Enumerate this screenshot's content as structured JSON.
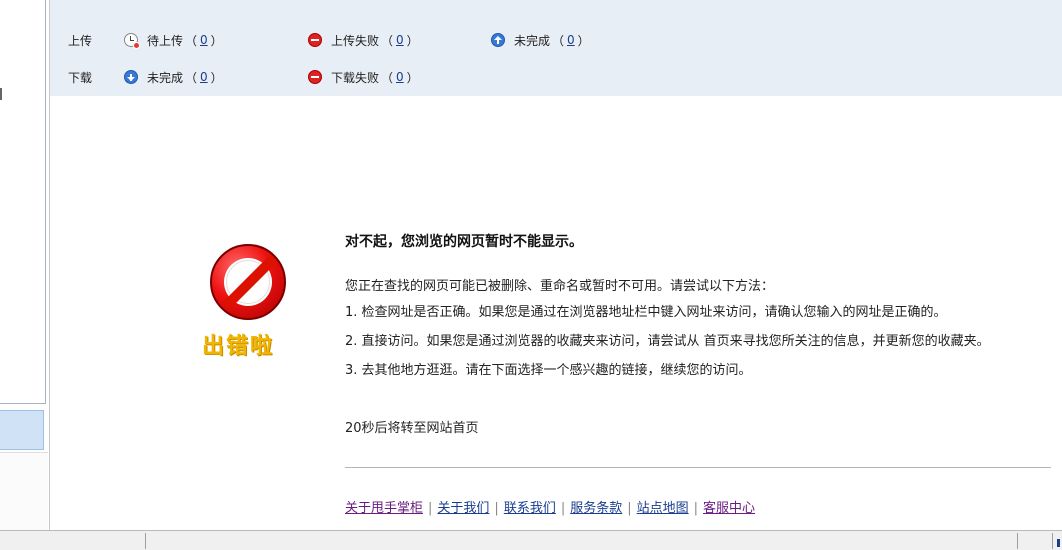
{
  "transfer": {
    "upload": {
      "label": "上传",
      "items": [
        {
          "icon": "clock-icon",
          "label": "待上传",
          "count": "0"
        },
        {
          "icon": "fail-icon",
          "label": "上传失败",
          "count": "0"
        },
        {
          "icon": "arrow-up-icon",
          "label": "未完成",
          "count": "0"
        }
      ]
    },
    "download": {
      "label": "下载",
      "items": [
        {
          "icon": "arrow-down-icon",
          "label": "未完成",
          "count": "0"
        },
        {
          "icon": "fail-icon",
          "label": "下载失败",
          "count": "0"
        }
      ]
    },
    "paren_open": "（",
    "paren_close": "）"
  },
  "error": {
    "graphic_text": "出错啦",
    "title": "对不起，您浏览的网页暂时不能显示。",
    "intro": "您正在查找的网页可能已被删除、重命名或暂时不可用。请尝试以下方法：",
    "tips": [
      "1. 检查网址是否正确。如果您是通过在浏览器地址栏中键入网址来访问，请确认您输入的网址是正确的。",
      "2. 直接访问。如果您是通过浏览器的收藏夹来访问，请尝试从  首页来寻找您所关注的信息，并更新您的收藏夹。",
      "3. 去其他地方逛逛。请在下面选择一个感兴趣的链接，继续您的访问。"
    ],
    "countdown": "20秒后将转至网站首页"
  },
  "footer": {
    "links": [
      "关于甩手掌柜",
      "关于我们",
      "联系我们",
      "服务条款",
      "站点地图",
      "客服中心"
    ],
    "separator": "|"
  },
  "colors": {
    "link": "#1a3d8f",
    "visited_link": "#6b1e82",
    "header_bg": "#e8eef5",
    "error_word": "#f2b600",
    "error_red": "#e11111"
  }
}
